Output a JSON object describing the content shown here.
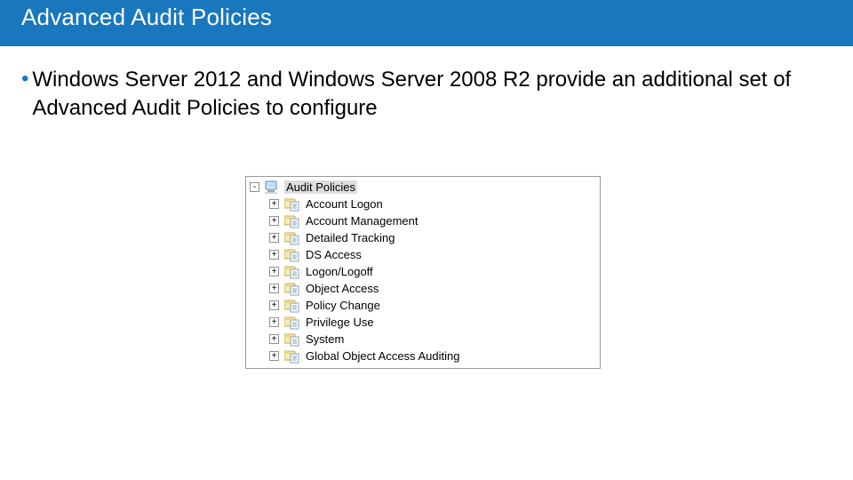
{
  "title": "Advanced Audit Policies",
  "bullet": "Windows Server 2012 and Windows Server 2008 R2 provide an additional set of Advanced Audit Policies to configure",
  "tree": {
    "root": {
      "label": "Audit Policies",
      "expander": "-"
    },
    "children": [
      {
        "label": "Account Logon",
        "expander": "+"
      },
      {
        "label": "Account Management",
        "expander": "+"
      },
      {
        "label": "Detailed Tracking",
        "expander": "+"
      },
      {
        "label": "DS Access",
        "expander": "+"
      },
      {
        "label": "Logon/Logoff",
        "expander": "+"
      },
      {
        "label": "Object Access",
        "expander": "+"
      },
      {
        "label": "Policy Change",
        "expander": "+"
      },
      {
        "label": "Privilege Use",
        "expander": "+"
      },
      {
        "label": "System",
        "expander": "+"
      },
      {
        "label": "Global Object Access Auditing",
        "expander": "+"
      }
    ]
  }
}
